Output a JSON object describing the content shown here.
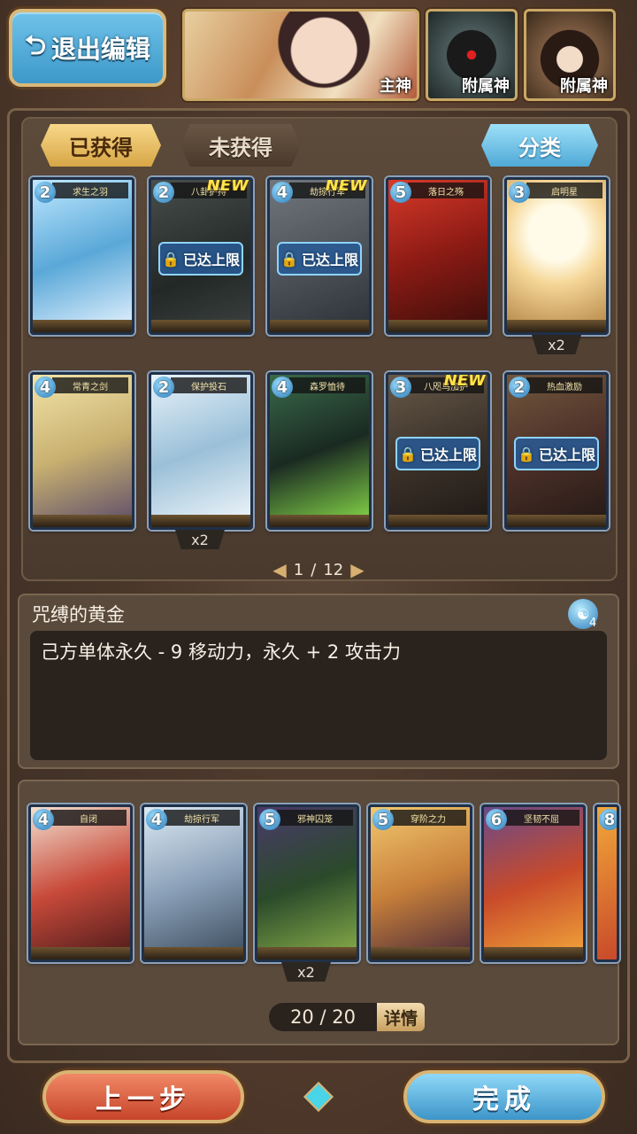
{
  "header": {
    "exit_label": "退出编辑",
    "gods": [
      {
        "label": "主神"
      },
      {
        "label": "附属神"
      },
      {
        "label": "附属神"
      }
    ]
  },
  "tabs": {
    "owned": "已获得",
    "unowned": "未获得",
    "category": "分类"
  },
  "collection": {
    "locked_label": "已达上限",
    "new_label": "NEW",
    "cards": [
      {
        "cost": "2",
        "title": "求生之羽",
        "new": false,
        "locked": false,
        "count": ""
      },
      {
        "cost": "2",
        "title": "八卦护持",
        "new": true,
        "locked": true,
        "count": ""
      },
      {
        "cost": "4",
        "title": "劫掠行军",
        "new": true,
        "locked": true,
        "count": ""
      },
      {
        "cost": "5",
        "title": "落日之殇",
        "new": false,
        "locked": false,
        "count": ""
      },
      {
        "cost": "3",
        "title": "启明星",
        "new": false,
        "locked": false,
        "count": "x2"
      },
      {
        "cost": "4",
        "title": "常青之剑",
        "new": false,
        "locked": false,
        "count": ""
      },
      {
        "cost": "2",
        "title": "保护投石",
        "new": false,
        "locked": false,
        "count": "x2"
      },
      {
        "cost": "4",
        "title": "森罗恤待",
        "new": false,
        "locked": false,
        "count": ""
      },
      {
        "cost": "3",
        "title": "八咫乌加护",
        "new": true,
        "locked": true,
        "count": ""
      },
      {
        "cost": "2",
        "title": "热血激励",
        "new": false,
        "locked": true,
        "count": ""
      }
    ],
    "pager": {
      "current": "1",
      "separator": "/",
      "total": "12"
    }
  },
  "description": {
    "title": "咒缚的黄金",
    "cost": "4",
    "text": "己方单体永久 - 9 移动力，永久 + 2 攻击力"
  },
  "deck": {
    "cards": [
      {
        "cost": "4",
        "title": "自闭",
        "count": ""
      },
      {
        "cost": "4",
        "title": "劫掠行军",
        "count": ""
      },
      {
        "cost": "5",
        "title": "邪神囚笼",
        "count": "x2"
      },
      {
        "cost": "5",
        "title": "穿阶之力",
        "count": ""
      },
      {
        "cost": "6",
        "title": "坚韧不屈",
        "count": ""
      },
      {
        "cost": "8",
        "title": "",
        "count": ""
      }
    ],
    "count_text": "20 / 20",
    "detail_label": "详情"
  },
  "footer": {
    "prev_label": "上一步",
    "done_label": "完成"
  }
}
